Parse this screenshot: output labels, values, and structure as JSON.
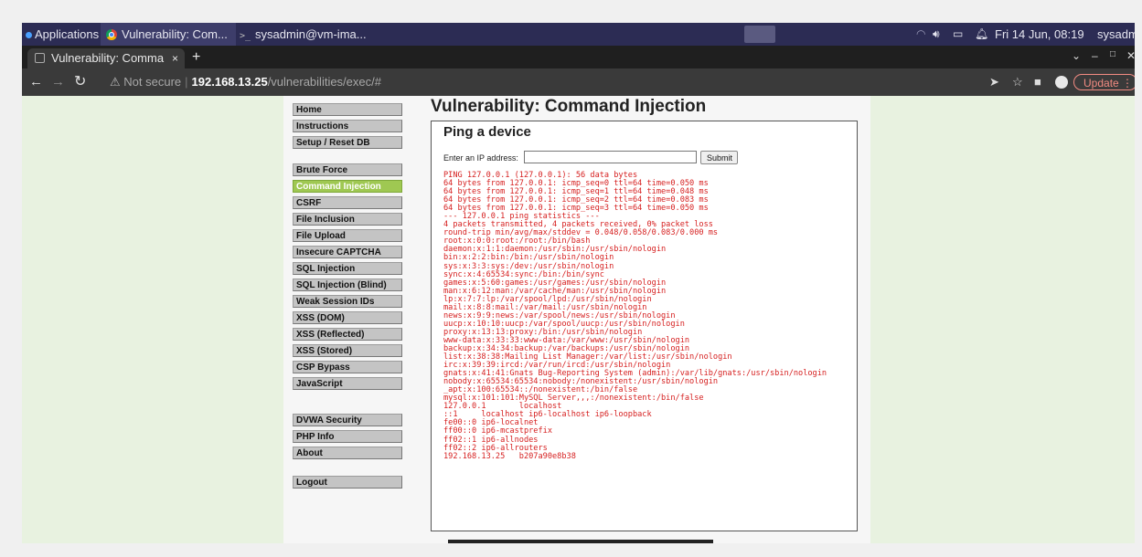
{
  "taskbar": {
    "applications": "Applications",
    "task_browser": "Vulnerability: Com...",
    "task_terminal": "sysadmin@vm-ima...",
    "datetime": "Fri 14 Jun, 08:19",
    "user": "sysadm"
  },
  "tabs": [
    {
      "title": "Vulnerability: Comma"
    }
  ],
  "tab_close": "×",
  "new_tab": "+",
  "address": {
    "not_secure": "Not secure",
    "host": "192.168.13.25",
    "path": "/vulnerabilities/exec/#"
  },
  "update_label": "Update",
  "menu": {
    "items": [
      "Home",
      "Instructions",
      "Setup / Reset DB",
      "Brute Force",
      "Command Injection",
      "CSRF",
      "File Inclusion",
      "File Upload",
      "Insecure CAPTCHA",
      "SQL Injection",
      "SQL Injection (Blind)",
      "Weak Session IDs",
      "XSS (DOM)",
      "XSS (Reflected)",
      "XSS (Stored)",
      "CSP Bypass",
      "JavaScript",
      "DVWA Security",
      "PHP Info",
      "About",
      "Logout"
    ],
    "active": "Command Injection"
  },
  "page_title": "Vulnerability: Command Injection",
  "box": {
    "heading": "Ping a device",
    "ip_label": "Enter an IP address:",
    "ip_value": "",
    "submit_label": "Submit",
    "output_lines": [
      "PING 127.0.0.1 (127.0.0.1): 56 data bytes",
      "64 bytes from 127.0.0.1: icmp_seq=0 ttl=64 time=0.050 ms",
      "64 bytes from 127.0.0.1: icmp_seq=1 ttl=64 time=0.048 ms",
      "64 bytes from 127.0.0.1: icmp_seq=2 ttl=64 time=0.083 ms",
      "64 bytes from 127.0.0.1: icmp_seq=3 ttl=64 time=0.050 ms",
      "--- 127.0.0.1 ping statistics ---",
      "4 packets transmitted, 4 packets received, 0% packet loss",
      "round-trip min/avg/max/stddev = 0.048/0.058/0.083/0.000 ms",
      "root:x:0:0:root:/root:/bin/bash",
      "daemon:x:1:1:daemon:/usr/sbin:/usr/sbin/nologin",
      "bin:x:2:2:bin:/bin:/usr/sbin/nologin",
      "sys:x:3:3:sys:/dev:/usr/sbin/nologin",
      "sync:x:4:65534:sync:/bin:/bin/sync",
      "games:x:5:60:games:/usr/games:/usr/sbin/nologin",
      "man:x:6:12:man:/var/cache/man:/usr/sbin/nologin",
      "lp:x:7:7:lp:/var/spool/lpd:/usr/sbin/nologin",
      "mail:x:8:8:mail:/var/mail:/usr/sbin/nologin",
      "news:x:9:9:news:/var/spool/news:/usr/sbin/nologin",
      "uucp:x:10:10:uucp:/var/spool/uucp:/usr/sbin/nologin",
      "proxy:x:13:13:proxy:/bin:/usr/sbin/nologin",
      "www-data:x:33:33:www-data:/var/www:/usr/sbin/nologin",
      "backup:x:34:34:backup:/var/backups:/usr/sbin/nologin",
      "list:x:38:38:Mailing List Manager:/var/list:/usr/sbin/nologin",
      "irc:x:39:39:ircd:/var/run/ircd:/usr/sbin/nologin",
      "gnats:x:41:41:Gnats Bug-Reporting System (admin):/var/lib/gnats:/usr/sbin/nologin",
      "nobody:x:65534:65534:nobody:/nonexistent:/usr/sbin/nologin",
      "_apt:x:100:65534::/nonexistent:/bin/false",
      "mysql:x:101:101:MySQL Server,,,:/nonexistent:/bin/false",
      "127.0.0.1       localhost",
      "::1     localhost ip6-localhost ip6-loopback",
      "fe00::0 ip6-localnet",
      "ff00::0 ip6-mcastprefix",
      "ff02::1 ip6-allnodes",
      "ff02::2 ip6-allrouters",
      "192.168.13.25   b207a90e8b38"
    ]
  }
}
